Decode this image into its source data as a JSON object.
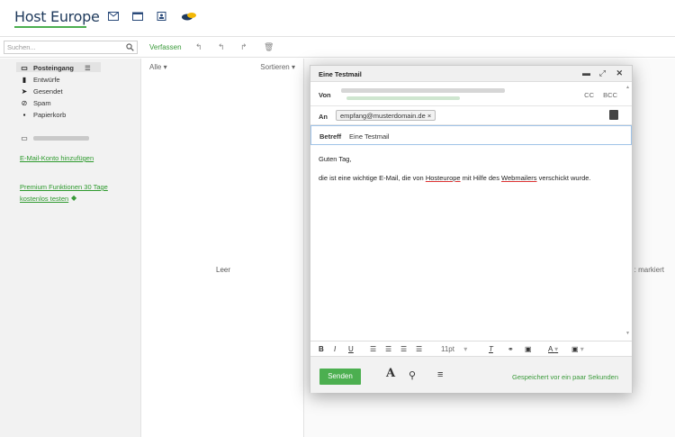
{
  "brand": {
    "logo_text": "Host Europe",
    "accent": "#4caf50",
    "dark": "#1f3a5c"
  },
  "topnav": {
    "icons": [
      "mail-icon",
      "calendar-icon",
      "contacts-icon",
      "cloud-icon"
    ]
  },
  "toolbar": {
    "search_placeholder": "Suchen...",
    "compose_label": "Verfassen"
  },
  "sidebar": {
    "folders": [
      {
        "label": "Posteingang",
        "icon": "inbox-icon"
      },
      {
        "label": "Entwürfe",
        "icon": "draft-icon"
      },
      {
        "label": "Gesendet",
        "icon": "send-icon"
      },
      {
        "label": "Spam",
        "icon": "spam-icon"
      },
      {
        "label": "Papierkorb",
        "icon": "trash-icon"
      }
    ],
    "add_account": "E-Mail-Konto hinzufügen",
    "premium_line1": "Premium Funktionen 30 Tage",
    "premium_line2": "kostenlos testen"
  },
  "list": {
    "filter_label": "Alle",
    "sort_label": "Sortieren",
    "empty_label": "Leer"
  },
  "reading": {
    "marked_label": ": markiert"
  },
  "dialog": {
    "title": "Eine Testmail",
    "from_label": "Von",
    "cc_label": "CC",
    "bcc_label": "BCC",
    "to_label": "An",
    "to_chip": "empfang@musterdomain.de ×",
    "subject_label": "Betreff",
    "subject_value": "Eine Testmail",
    "greeting": "Guten Tag,",
    "body_prefix": "die ist eine wichtige E-Mail, die von ",
    "body_word1": "Hosteurope",
    "body_mid": " mit Hilfe des ",
    "body_word2": "Webmailers",
    "body_suffix": " verschickt wurde.",
    "font_size": "11pt",
    "send_label": "Senden",
    "saved_status": "Gespeichert vor ein paar Sekunden"
  }
}
